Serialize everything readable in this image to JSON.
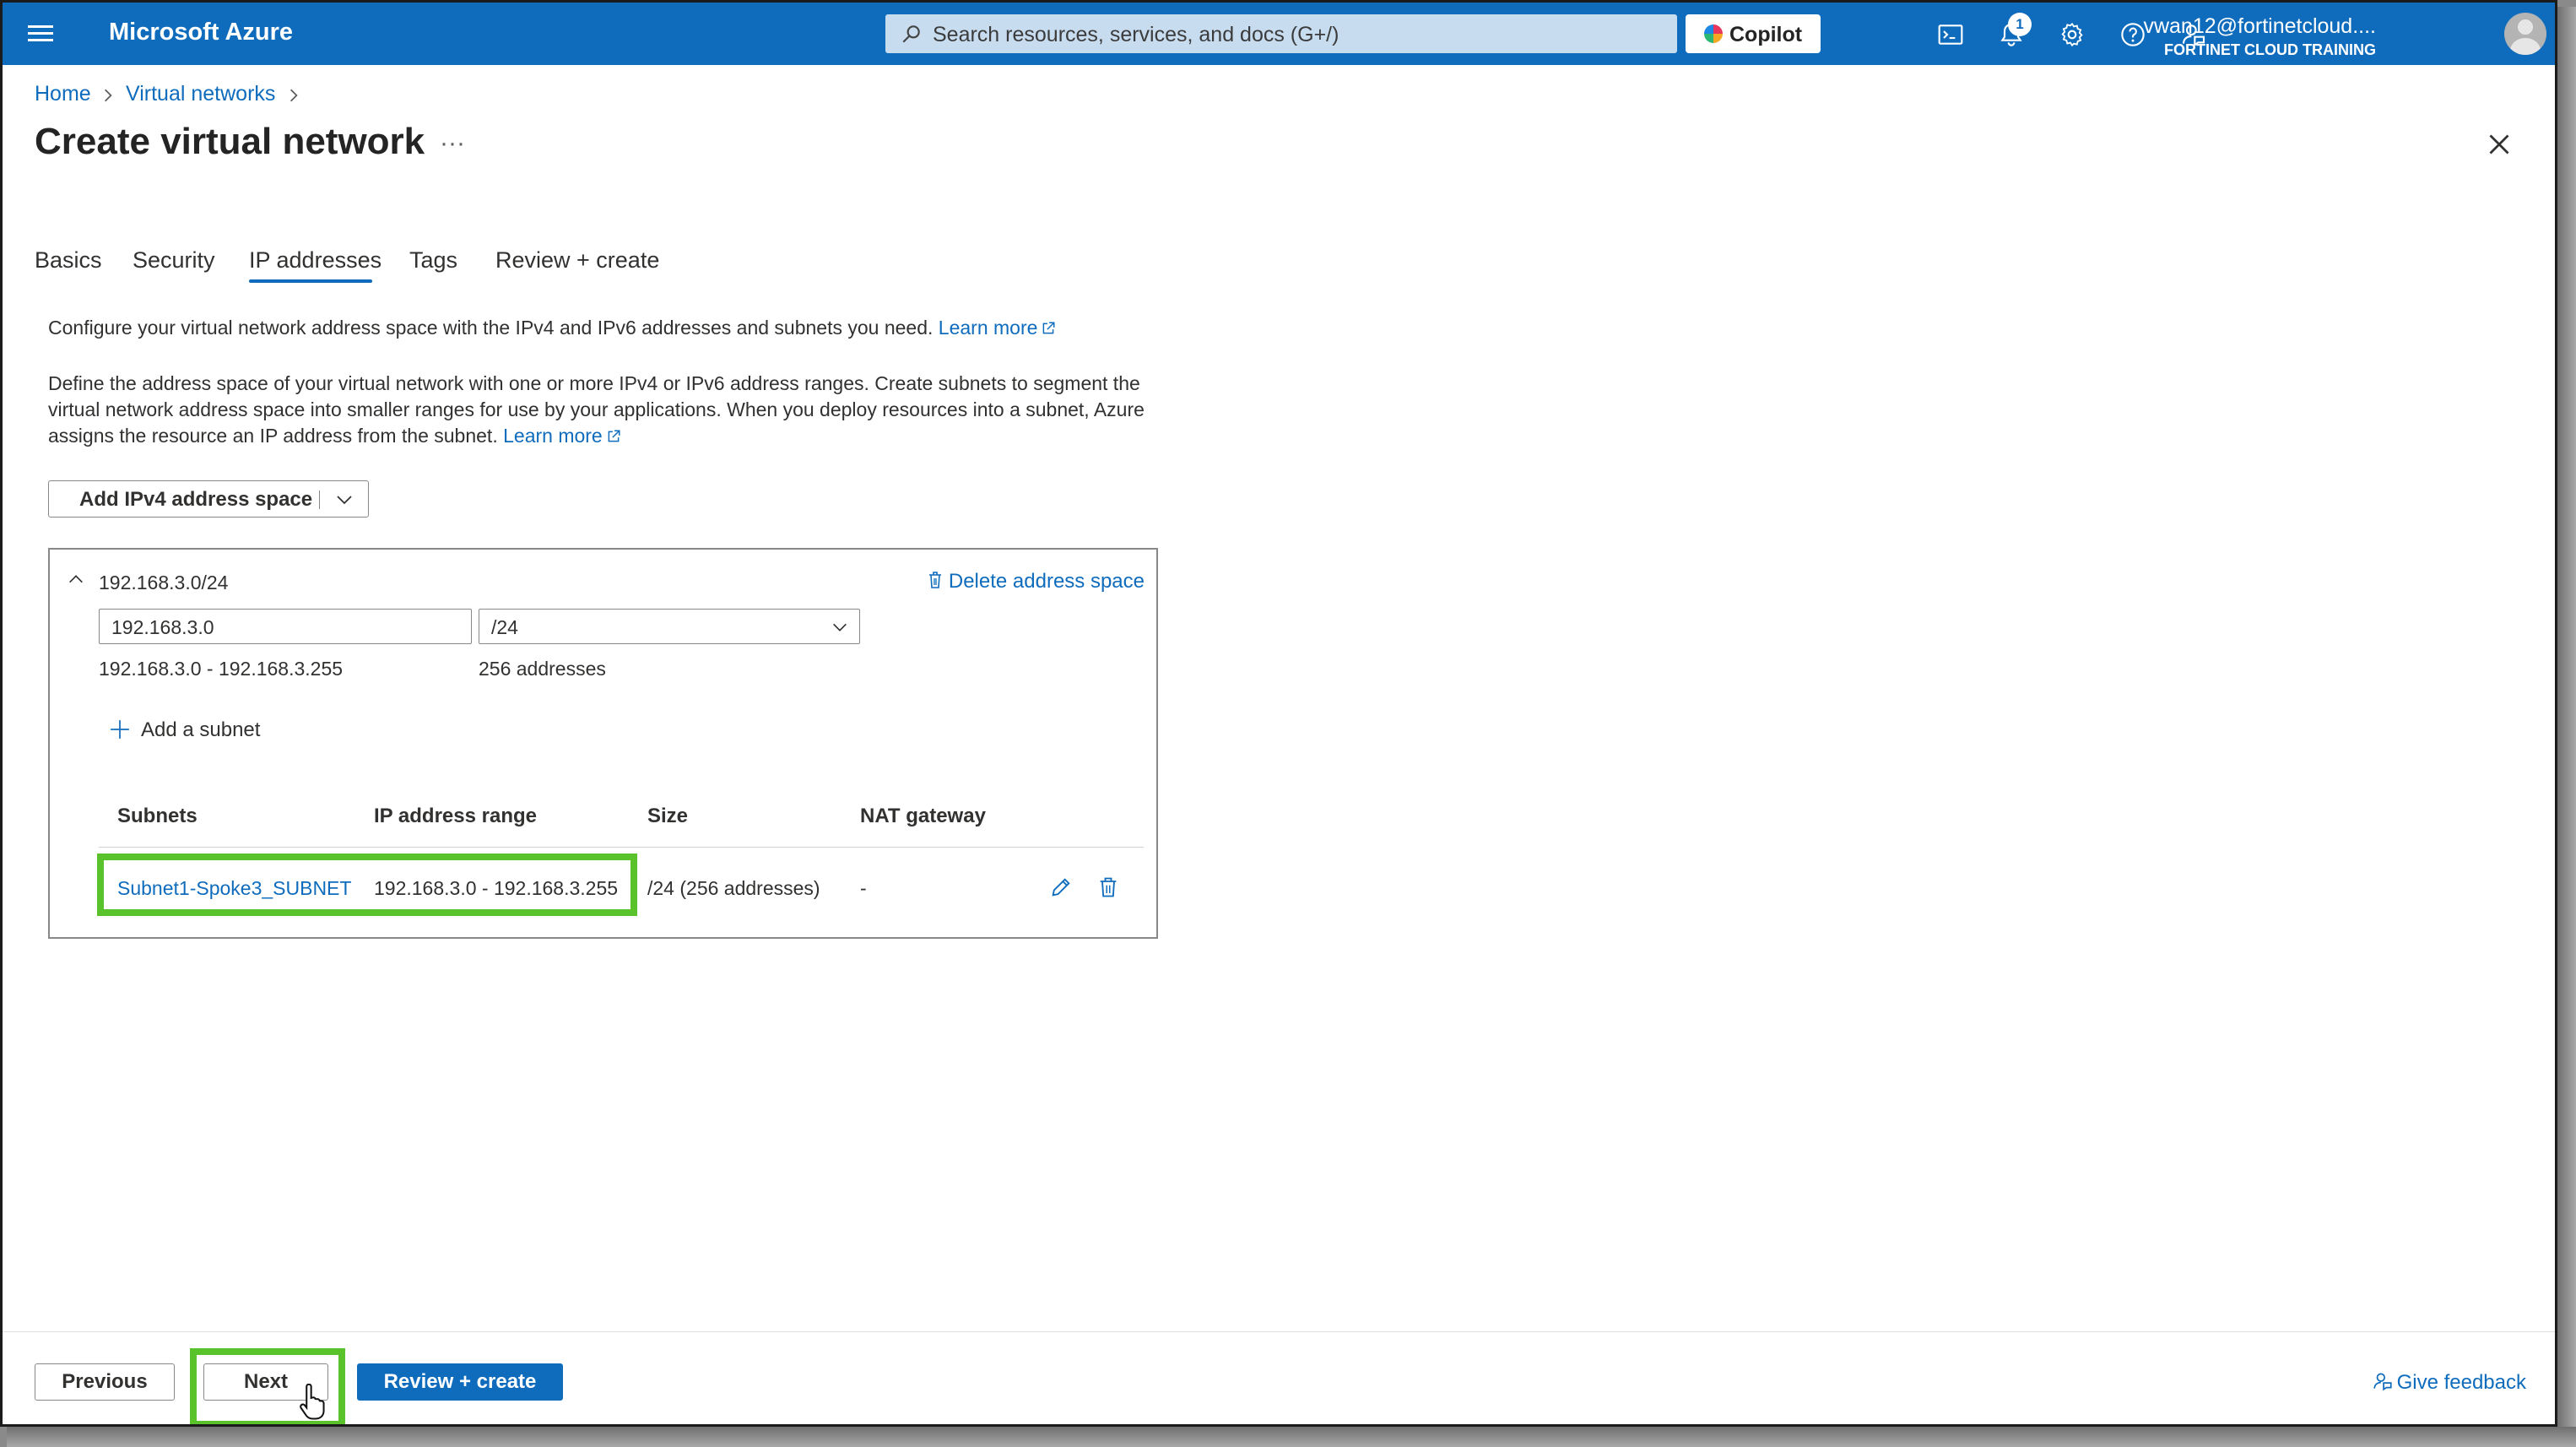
{
  "topbar": {
    "brand": "Microsoft Azure",
    "search_placeholder": "Search resources, services, and docs (G+/)",
    "copilot_label": "Copilot",
    "notification_count": "1",
    "user_email": "vwan12@fortinetcloud....",
    "user_org": "FORTINET CLOUD TRAINING",
    "icons": [
      "menu-icon",
      "search-icon",
      "cloud-shell-icon",
      "bell-icon",
      "gear-icon",
      "help-icon",
      "feedback-icon"
    ]
  },
  "breadcrumb": [
    "Home",
    "Virtual networks"
  ],
  "page_title": "Create virtual network",
  "title_more": "···",
  "tabs": [
    "Basics",
    "Security",
    "IP addresses",
    "Tags",
    "Review + create"
  ],
  "active_tab": "IP addresses",
  "intro": {
    "text": "Configure your virtual network address space with the IPv4 and IPv6 addresses and subnets you need.",
    "link": "Learn more"
  },
  "description": {
    "line1": "Define the address space of your virtual network with one or more IPv4 or IPv6 address ranges. Create subnets to segment the",
    "line2": "virtual network address space into smaller ranges for use by your applications. When you deploy resources into a subnet, Azure",
    "line3": "assigns the resource an IP address from the subnet.",
    "link": "Learn more"
  },
  "add_space_button": "Add IPv4 address space",
  "address_space": {
    "title": "192.168.3.0/24",
    "delete_label": "Delete address space",
    "address_value": "192.168.3.0",
    "prefix_value": "/24",
    "range": "192.168.3.0 - 192.168.3.255",
    "count": "256 addresses",
    "add_subnet_label": "Add a subnet",
    "columns": [
      "Subnets",
      "IP address range",
      "Size",
      "NAT gateway"
    ],
    "rows": [
      {
        "name": "Subnet1-Spoke3_SUBNET",
        "range": "192.168.3.0 - 192.168.3.255",
        "size": "/24 (256 addresses)",
        "nat": "-"
      }
    ]
  },
  "footer": {
    "previous": "Previous",
    "next": "Next",
    "review": "Review + create",
    "feedback": "Give feedback"
  },
  "colors": {
    "brand": "#0f6cbd",
    "highlight": "#5ac32b"
  }
}
